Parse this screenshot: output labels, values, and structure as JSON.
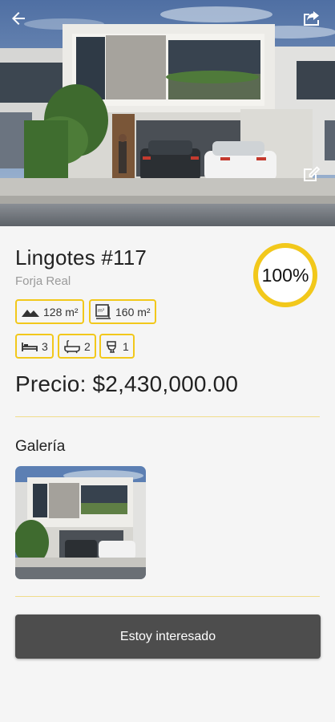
{
  "hero": {
    "image": "house-facade-photo",
    "back_icon": "arrow-left-icon",
    "share_icon": "share-icon",
    "edit_icon": "edit-icon"
  },
  "property": {
    "title": "Lingotes #117",
    "subtitle": "Forja Real",
    "completion": {
      "label": "100%",
      "fraction": 1.0,
      "color": "#f2c81b"
    },
    "features": {
      "land_area": {
        "icon": "terrain-icon",
        "value": "128 m²"
      },
      "built_area": {
        "icon": "floor-plan-icon",
        "value": "160 m²"
      },
      "bedrooms": {
        "icon": "bed-icon",
        "value": "3"
      },
      "bathrooms": {
        "icon": "bathtub-icon",
        "value": "2"
      },
      "toilets": {
        "icon": "toilet-icon",
        "value": "1"
      }
    },
    "price": "Precio: $2,430,000.00"
  },
  "gallery": {
    "title": "Galería",
    "thumbnails": [
      "house-facade-thumbnail"
    ]
  },
  "cta": {
    "label": "Estoy interesado"
  },
  "colors": {
    "accent": "#f2c81b",
    "button": "#4d4d4d",
    "background": "#f5f5f5"
  }
}
